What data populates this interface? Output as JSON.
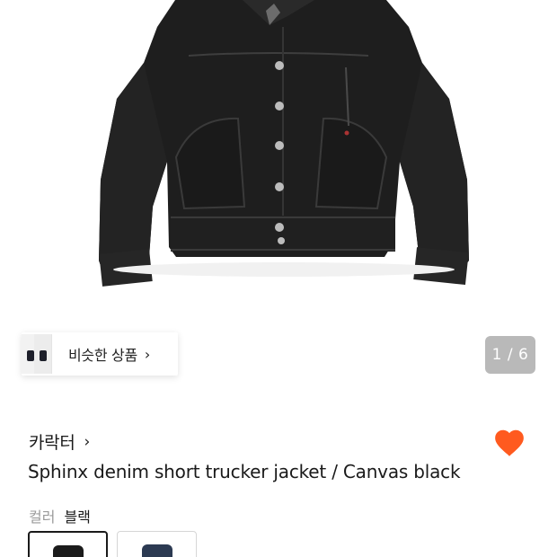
{
  "product": {
    "image_alt": "Black denim trucker jacket",
    "brand": "카락터",
    "title": "Sphinx denim short trucker jacket / Canvas black",
    "liked": true
  },
  "gallery": {
    "counter": "1 / 6"
  },
  "similar": {
    "label": "비슷한 상품",
    "chevron": "›"
  },
  "brand_chevron": "›",
  "color_option": {
    "label": "컬러",
    "value": "블랙",
    "swatches": [
      {
        "name": "black",
        "selected": true
      },
      {
        "name": "navy",
        "selected": false
      }
    ]
  },
  "colors": {
    "heart": "#ff5a1f",
    "jacket": "#1c1c1c",
    "counter_bg": "#b9b9b9"
  },
  "icons": [
    "heart-icon",
    "chevron-right-icon"
  ]
}
